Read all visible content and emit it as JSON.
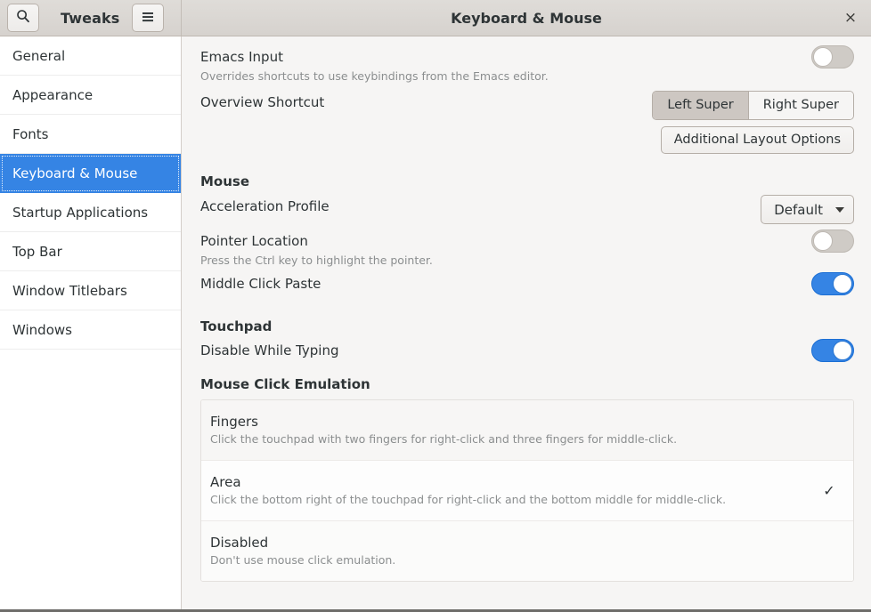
{
  "header": {
    "app_title": "Tweaks",
    "page_title": "Keyboard & Mouse",
    "search_icon": "search-icon",
    "menu_icon": "hamburger-menu-icon",
    "close_label": "×"
  },
  "sidebar": {
    "items": [
      {
        "label": "General",
        "selected": false
      },
      {
        "label": "Appearance",
        "selected": false
      },
      {
        "label": "Fonts",
        "selected": false
      },
      {
        "label": "Keyboard & Mouse",
        "selected": true
      },
      {
        "label": "Startup Applications",
        "selected": false
      },
      {
        "label": "Top Bar",
        "selected": false
      },
      {
        "label": "Window Titlebars",
        "selected": false
      },
      {
        "label": "Windows",
        "selected": false
      }
    ]
  },
  "keyboard": {
    "emacs_input": {
      "title": "Emacs Input",
      "subtitle": "Overrides shortcuts to use keybindings from the Emacs editor.",
      "toggle_state": "off"
    },
    "overview_shortcut": {
      "title": "Overview Shortcut",
      "options": [
        {
          "label": "Left Super",
          "active": true
        },
        {
          "label": "Right Super",
          "active": false
        }
      ],
      "additional_button": "Additional Layout Options"
    }
  },
  "mouse": {
    "section_title": "Mouse",
    "acceleration_profile": {
      "title": "Acceleration Profile",
      "value": "Default"
    },
    "pointer_location": {
      "title": "Pointer Location",
      "subtitle": "Press the Ctrl key to highlight the pointer.",
      "toggle_state": "off"
    },
    "middle_click_paste": {
      "title": "Middle Click Paste",
      "toggle_state": "on"
    }
  },
  "touchpad": {
    "section_title": "Touchpad",
    "disable_while_typing": {
      "title": "Disable While Typing",
      "toggle_state": "on"
    },
    "click_emulation": {
      "section_title": "Mouse Click Emulation",
      "selected": "Area",
      "options": [
        {
          "title": "Fingers",
          "subtitle": "Click the touchpad with two fingers for right-click and three fingers for middle-click.",
          "checked": false
        },
        {
          "title": "Area",
          "subtitle": "Click the bottom right of the touchpad for right-click and the bottom middle for middle-click.",
          "checked": true
        },
        {
          "title": "Disabled",
          "subtitle": "Don't use mouse click emulation.",
          "checked": false
        }
      ]
    }
  },
  "colors": {
    "accent": "#3584e4",
    "headerbar": "#d6d2ce",
    "content_bg": "#f6f5f4",
    "sidebar_bg": "#ffffff",
    "text": "#2e3436",
    "subtext": "#8b8e8f"
  }
}
